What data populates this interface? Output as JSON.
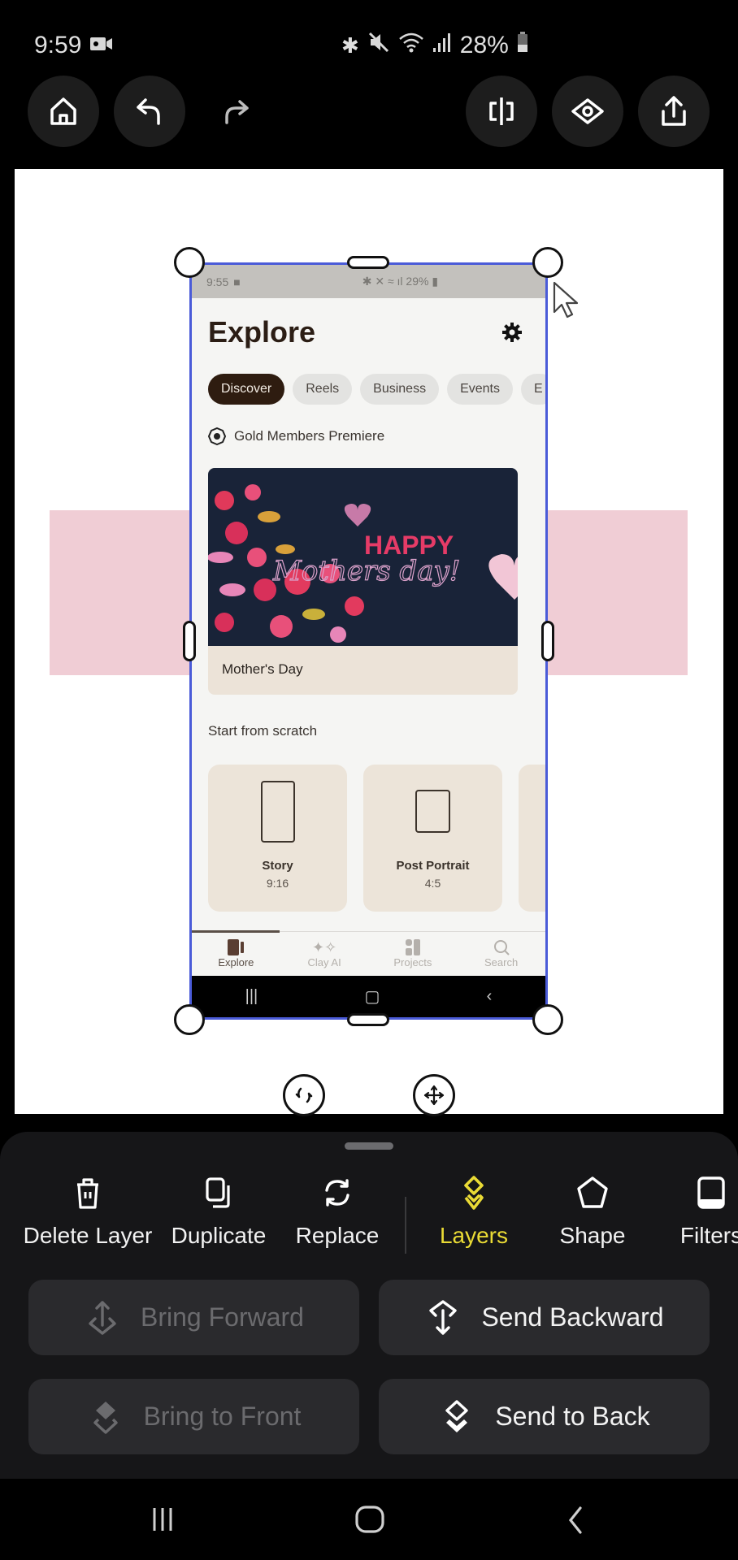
{
  "status_bar": {
    "time": "9:59",
    "battery": "28%",
    "icons": [
      "video-record-icon",
      "bluetooth-icon",
      "mute-icon",
      "wifi-icon",
      "signal-icon",
      "battery-icon"
    ]
  },
  "toolbar": {
    "left": [
      {
        "name": "home",
        "icon": "home-icon"
      },
      {
        "name": "undo",
        "icon": "undo-icon"
      },
      {
        "name": "redo",
        "icon": "redo-icon"
      }
    ],
    "right": [
      {
        "name": "split",
        "icon": "split-icon"
      },
      {
        "name": "preview",
        "icon": "eye-icon"
      },
      {
        "name": "share",
        "icon": "share-icon"
      }
    ]
  },
  "canvas": {
    "background_color": "#ffffff",
    "shape_color": "#f0cdd5",
    "selection_color": "#4a5bd8",
    "layer": {
      "status_time": "9:55",
      "status_battery": "29%",
      "title": "Explore",
      "chips": [
        "Discover",
        "Reels",
        "Business",
        "Events",
        "E"
      ],
      "active_chip": "Discover",
      "section_badge": "Gold Members Premiere",
      "featured": {
        "image_text_top": "HAPPY",
        "image_text_script": "Mothers day!",
        "caption": "Mother's Day"
      },
      "scratch_heading": "Start from scratch",
      "templates": [
        {
          "name": "Story",
          "ratio": "9:16"
        },
        {
          "name": "Post Portrait",
          "ratio": "4:5"
        }
      ],
      "tabs": [
        {
          "label": "Explore",
          "icon": "explore-icon",
          "active": true
        },
        {
          "label": "Clay AI",
          "icon": "sparkle-icon",
          "active": false
        },
        {
          "label": "Projects",
          "icon": "projects-icon",
          "active": false
        },
        {
          "label": "Search",
          "icon": "search-icon",
          "active": false
        }
      ]
    }
  },
  "tools": [
    {
      "label": "Delete Layer",
      "icon": "trash-icon"
    },
    {
      "label": "Duplicate",
      "icon": "duplicate-icon"
    },
    {
      "label": "Replace",
      "icon": "replace-icon"
    },
    {
      "label": "Layers",
      "icon": "layers-icon",
      "active": true
    },
    {
      "label": "Shape",
      "icon": "pentagon-icon"
    },
    {
      "label": "Filters",
      "icon": "filters-icon"
    }
  ],
  "accent_color": "#eadb35",
  "layer_actions": [
    {
      "label": "Bring Forward",
      "enabled": false
    },
    {
      "label": "Send Backward",
      "enabled": true
    },
    {
      "label": "Bring to Front",
      "enabled": false
    },
    {
      "label": "Send to Back",
      "enabled": true
    }
  ]
}
